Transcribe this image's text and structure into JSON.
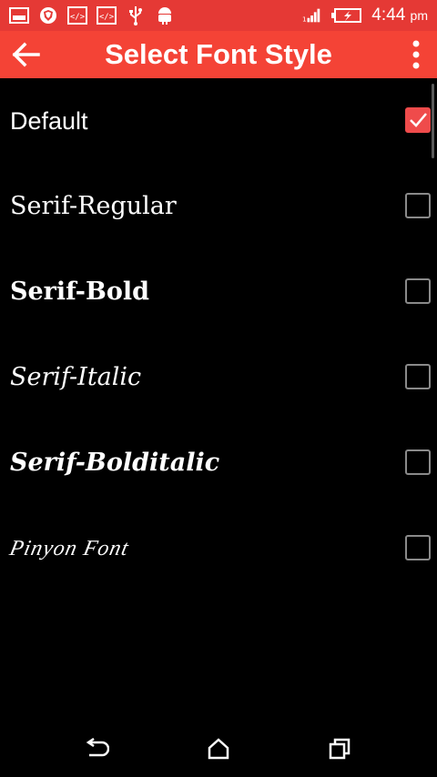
{
  "status_bar": {
    "time": "4:44",
    "ampm": "pm",
    "icons": [
      "gallery-icon",
      "shield-icon",
      "code-icon",
      "code-icon",
      "usb-icon",
      "android-icon",
      "signal-icon",
      "battery-charging-icon"
    ]
  },
  "toolbar": {
    "title": "Select Font Style",
    "accent": "#f44336"
  },
  "fonts": [
    {
      "label": "Default",
      "checked": true
    },
    {
      "label": "Serif-Regular",
      "checked": false
    },
    {
      "label": "Serif-Bold",
      "checked": false
    },
    {
      "label": "Serif-Italic",
      "checked": false
    },
    {
      "label": "Serif-Bolditalic",
      "checked": false
    },
    {
      "label": "Pinyon Font",
      "checked": false
    }
  ],
  "nav": {
    "buttons": [
      "back-icon",
      "home-icon",
      "recents-icon"
    ]
  }
}
